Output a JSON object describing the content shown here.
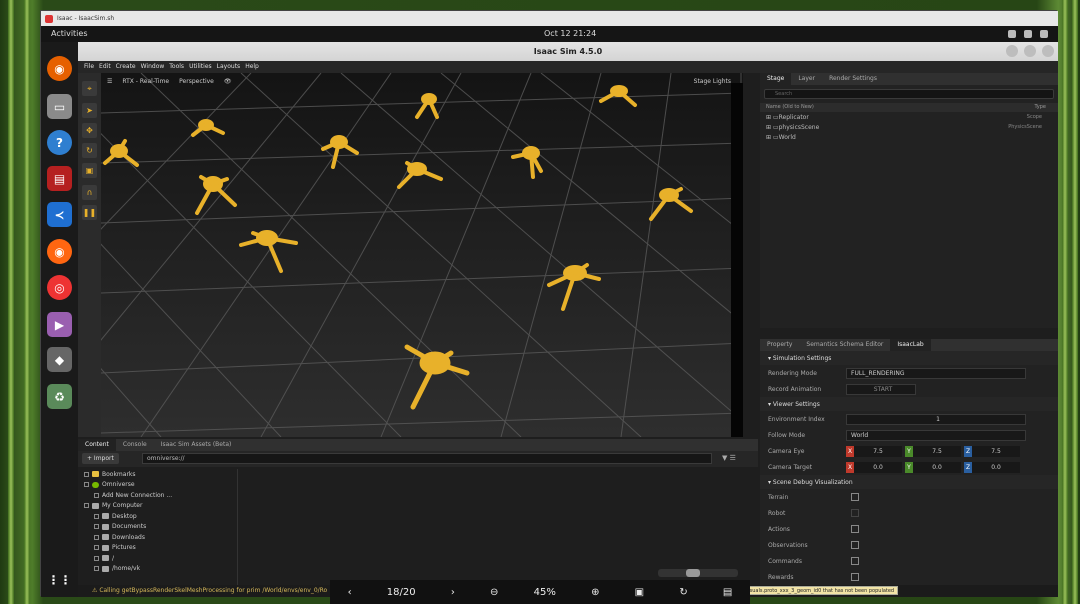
{
  "os": {
    "topbar_title": "Isaac - IsaacSim.sh",
    "activities": "Activities",
    "clock": "Oct 12  21:24"
  },
  "window": {
    "title": "Isaac Sim 4.5.0"
  },
  "menu": [
    "File",
    "Edit",
    "Create",
    "Window",
    "Tools",
    "Utilities",
    "Layouts",
    "Help"
  ],
  "viewport": {
    "render_mode": "RTX - Real-Time",
    "camera": "Perspective",
    "lights": "Stage Lights"
  },
  "stage": {
    "tabs": [
      "Stage",
      "Layer",
      "Render Settings"
    ],
    "search_placeholder": "Search",
    "col_name": "Name (Old to New)",
    "col_type": "Type",
    "rows": [
      {
        "name": "Replicator",
        "type": "Scope"
      },
      {
        "name": "physicsScene",
        "type": "PhysicsScene"
      },
      {
        "name": "World",
        "type": ""
      }
    ]
  },
  "props": {
    "tabs": [
      "Property",
      "Semantics Schema Editor",
      "IsaacLab"
    ],
    "sim_settings": "Simulation Settings",
    "rendering_mode_label": "Rendering Mode",
    "rendering_mode": "FULL_RENDERING",
    "record_anim_label": "Record Animation",
    "record_btn": "START",
    "viewer_settings": "Viewer Settings",
    "env_index_label": "Environment Index",
    "env_index": "1",
    "follow_mode_label": "Follow Mode",
    "follow_mode": "World",
    "cam_eye_label": "Camera Eye",
    "cam_eye": [
      "7.5",
      "7.5",
      "7.5"
    ],
    "cam_target_label": "Camera Target",
    "cam_target": [
      "0.0",
      "0.0",
      "0.0"
    ],
    "xyz": [
      "X",
      "Y",
      "Z"
    ],
    "debug_vis": "Scene Debug Visualization",
    "debug_items": [
      "Terrain",
      "Robot",
      "Actions",
      "Observations",
      "Commands",
      "Rewards"
    ]
  },
  "content": {
    "tabs": [
      "Content",
      "Console",
      "Isaac Sim Assets (Beta)"
    ],
    "import": "+ Import",
    "path": "omniverse://",
    "tree": [
      {
        "label": "Bookmarks",
        "indent": 0
      },
      {
        "label": "Omniverse",
        "indent": 0
      },
      {
        "label": "Add New Connection ...",
        "indent": 1
      },
      {
        "label": "My Computer",
        "indent": 0
      },
      {
        "label": "Desktop",
        "indent": 1
      },
      {
        "label": "Documents",
        "indent": 1
      },
      {
        "label": "Downloads",
        "indent": 1
      },
      {
        "label": "Pictures",
        "indent": 1
      },
      {
        "label": "/",
        "indent": 1
      },
      {
        "label": "/home/vk",
        "indent": 1
      }
    ]
  },
  "status_text": "Calling getBypassRenderSkelMeshProcessing for prim /World/envs/env_0/Ro",
  "tooltip": "/Robot/torso/visuals.proto_xxx_3_geom_id0 that has not been populated",
  "viewer": {
    "page": "18/20",
    "zoom": "45%"
  },
  "colors": {
    "robot": "#e8b12a",
    "accent": "#76b900"
  }
}
